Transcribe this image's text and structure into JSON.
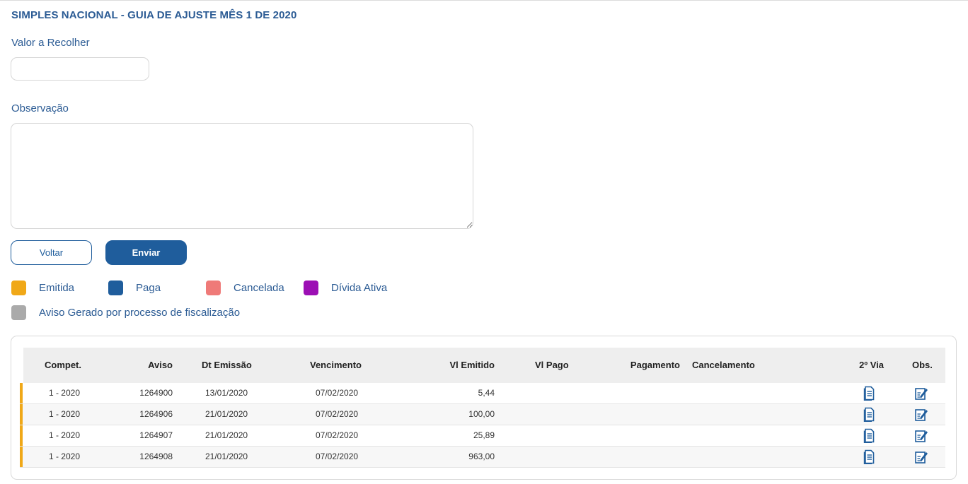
{
  "page": {
    "title": "SIMPLES NACIONAL - GUIA DE AJUSTE MÊS 1 DE 2020"
  },
  "form": {
    "valor_label": "Valor a Recolher",
    "valor_value": "",
    "observacao_label": "Observação",
    "observacao_value": "",
    "voltar_label": "Voltar",
    "enviar_label": "Enviar"
  },
  "legend": [
    {
      "label": "Emitida",
      "color": "#f0a818"
    },
    {
      "label": "Paga",
      "color": "#1f5d9c"
    },
    {
      "label": "Cancelada",
      "color": "#ef7a78"
    },
    {
      "label": "Dívida Ativa",
      "color": "#9c0fb4"
    },
    {
      "label": "Aviso Gerado por processo de fiscalização",
      "color": "#aaaaaa"
    }
  ],
  "table": {
    "headers": {
      "compet": "Compet.",
      "aviso": "Aviso",
      "dt_emissao": "Dt Emissão",
      "vencimento": "Vencimento",
      "vl_emitido": "Vl Emitido",
      "vl_pago": "Vl Pago",
      "pagamento": "Pagamento",
      "cancelamento": "Cancelamento",
      "segunda_via": "2º Via",
      "obs": "Obs."
    },
    "rows": [
      {
        "compet": "1 - 2020",
        "aviso": "1264900",
        "dt_emissao": "13/01/2020",
        "vencimento": "07/02/2020",
        "vl_emitido": "5,44",
        "vl_pago": "",
        "pagamento": "",
        "cancelamento": "",
        "status": "Emitida",
        "segunda_via_icon": "document-icon",
        "obs_icon": "edit-note-icon"
      },
      {
        "compet": "1 - 2020",
        "aviso": "1264906",
        "dt_emissao": "21/01/2020",
        "vencimento": "07/02/2020",
        "vl_emitido": "100,00",
        "vl_pago": "",
        "pagamento": "",
        "cancelamento": "",
        "status": "Emitida",
        "segunda_via_icon": "document-icon",
        "obs_icon": "edit-note-icon"
      },
      {
        "compet": "1 - 2020",
        "aviso": "1264907",
        "dt_emissao": "21/01/2020",
        "vencimento": "07/02/2020",
        "vl_emitido": "25,89",
        "vl_pago": "",
        "pagamento": "",
        "cancelamento": "",
        "status": "Emitida",
        "segunda_via_icon": "document-icon",
        "obs_icon": "edit-note-icon"
      },
      {
        "compet": "1 - 2020",
        "aviso": "1264908",
        "dt_emissao": "21/01/2020",
        "vencimento": "07/02/2020",
        "vl_emitido": "963,00",
        "vl_pago": "",
        "pagamento": "",
        "cancelamento": "",
        "status": "Emitida",
        "segunda_via_icon": "document-icon",
        "obs_icon": "edit-note-icon"
      }
    ]
  }
}
